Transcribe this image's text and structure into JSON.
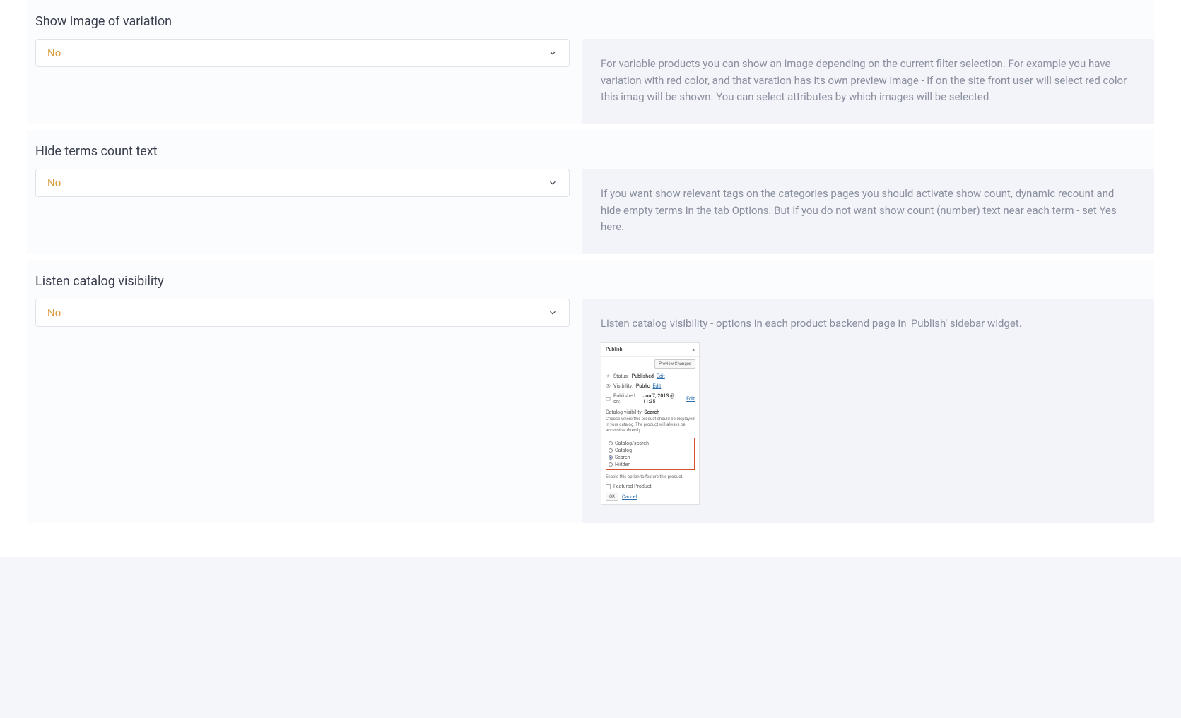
{
  "sections": [
    {
      "title": "Show image of variation",
      "select_value": "No",
      "description": "For variable products you can show an image depending on the current filter selection. For example you have variation with red color, and that varation has its own preview image - if on the site front user will select red color this imag will be shown. You can select attributes by which images will be selected"
    },
    {
      "title": "Hide terms count text",
      "select_value": "No",
      "description": "If you want show relevant tags on the categories pages you should activate show count, dynamic recount and hide empty terms in the tab Options. But if you do not want show count (number) text near each term - set Yes here."
    },
    {
      "title": "Listen catalog visibility",
      "select_value": "No",
      "description": "Listen catalog visibility - options in each product backend page in 'Publish' sidebar widget."
    }
  ],
  "publish_widget": {
    "title": "Publish",
    "preview_btn": "Preview Changes",
    "status": {
      "label": "Status:",
      "value": "Published",
      "link": "Edit"
    },
    "visibility": {
      "label": "Visibility:",
      "value": "Public",
      "link": "Edit"
    },
    "published": {
      "label": "Published on:",
      "value": "Jun 7, 2013 @ 11:35",
      "link": "Edit"
    },
    "catalog_visibility_label": "Catalog visibility:",
    "catalog_visibility_value": "Search",
    "choose_desc": "Choose where this product should be displayed in your catalog. The product will always be accessible directly.",
    "radios": [
      {
        "label": "Catalog/search",
        "selected": false
      },
      {
        "label": "Catalog",
        "selected": false
      },
      {
        "label": "Search",
        "selected": true
      },
      {
        "label": "Hidden",
        "selected": false
      }
    ],
    "enable_text": "Enable this option to feature this product.",
    "featured_label": "Featured Product",
    "ok": "OK",
    "cancel": "Cancel"
  }
}
